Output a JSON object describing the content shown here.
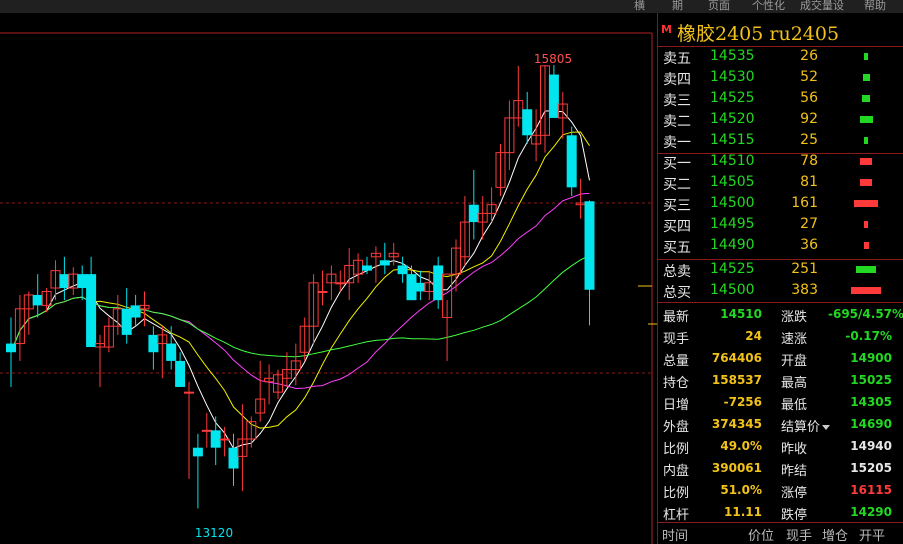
{
  "topbar": {
    "items": [
      "横",
      "期",
      "页面",
      "个性化",
      "成交量设",
      "帮助"
    ]
  },
  "chart": {
    "high_label": "15805",
    "low_label": "13120"
  },
  "chart_data": {
    "type": "candlestick",
    "ylim": [
      13000,
      16000
    ],
    "candles": [
      [
        14200,
        14350,
        13950,
        14150
      ],
      [
        14200,
        14480,
        14100,
        14400
      ],
      [
        14400,
        14500,
        14250,
        14480
      ],
      [
        14480,
        14600,
        14350,
        14420
      ],
      [
        14420,
        14520,
        14380,
        14500
      ],
      [
        14520,
        14680,
        14450,
        14620
      ],
      [
        14600,
        14700,
        14450,
        14520
      ],
      [
        14520,
        14640,
        14480,
        14600
      ],
      [
        14600,
        14650,
        14450,
        14520
      ],
      [
        14600,
        14700,
        14200,
        14180
      ],
      [
        14180,
        14250,
        13950,
        14200
      ],
      [
        14180,
        14350,
        14150,
        14300
      ],
      [
        14300,
        14480,
        14250,
        14400
      ],
      [
        14400,
        14520,
        14200,
        14250
      ],
      [
        14420,
        14480,
        14300,
        14350
      ],
      [
        14400,
        14500,
        14300,
        14420
      ],
      [
        14250,
        14300,
        14050,
        14150
      ],
      [
        14200,
        14300,
        14000,
        14250
      ],
      [
        14200,
        14300,
        14050,
        14100
      ],
      [
        14100,
        14150,
        13950,
        13950
      ],
      [
        13920,
        13980,
        13420,
        13920
      ],
      [
        13600,
        13680,
        13250,
        13550
      ],
      [
        13700,
        13800,
        13600,
        13700
      ],
      [
        13700,
        13780,
        13500,
        13600
      ],
      [
        13650,
        13720,
        13550,
        13650
      ],
      [
        13600,
        13680,
        13380,
        13480
      ],
      [
        13550,
        13850,
        13350,
        13650
      ],
      [
        13650,
        13780,
        13600,
        13750
      ],
      [
        13800,
        14100,
        13750,
        13880
      ],
      [
        13980,
        14080,
        13850,
        14000
      ],
      [
        13920,
        14050,
        13880,
        14020
      ],
      [
        14000,
        14150,
        13950,
        14050
      ],
      [
        14050,
        14200,
        13960,
        14100
      ],
      [
        14150,
        14350,
        14100,
        14300
      ],
      [
        14300,
        14600,
        14200,
        14550
      ],
      [
        14500,
        14620,
        14420,
        14500
      ],
      [
        14550,
        14650,
        14450,
        14600
      ],
      [
        14550,
        14620,
        14500,
        14550
      ],
      [
        14550,
        14750,
        14450,
        14650
      ],
      [
        14600,
        14720,
        14550,
        14680
      ],
      [
        14650,
        14700,
        14600,
        14620
      ],
      [
        14700,
        14760,
        14550,
        14720
      ],
      [
        14680,
        14780,
        14600,
        14650
      ],
      [
        14700,
        14780,
        14650,
        14720
      ],
      [
        14650,
        14700,
        14550,
        14600
      ],
      [
        14600,
        14650,
        14450,
        14450
      ],
      [
        14550,
        14620,
        14450,
        14500
      ],
      [
        14500,
        14620,
        14450,
        14550
      ],
      [
        14650,
        14700,
        14400,
        14450
      ],
      [
        14350,
        14450,
        14100,
        14600
      ],
      [
        14600,
        14800,
        14500,
        14750
      ],
      [
        14700,
        15050,
        14650,
        14900
      ],
      [
        15000,
        15200,
        14800,
        14900
      ],
      [
        14900,
        15050,
        14800,
        14950
      ],
      [
        14950,
        15100,
        14900,
        15000
      ],
      [
        15100,
        15350,
        15050,
        15300
      ],
      [
        15300,
        15600,
        15200,
        15500
      ],
      [
        15500,
        15800,
        15450,
        15600
      ],
      [
        15550,
        15650,
        15350,
        15400
      ],
      [
        15350,
        15550,
        15250,
        15400
      ],
      [
        15400,
        15805,
        15300,
        15800
      ],
      [
        15750,
        15805,
        15500,
        15500
      ],
      [
        15500,
        15650,
        15380,
        15580
      ],
      [
        15400,
        15450,
        15050,
        15100
      ],
      [
        15000,
        15150,
        14920,
        15010
      ],
      [
        15020,
        15025,
        14305,
        14510
      ]
    ],
    "ma_series": [
      {
        "color": "#ffffff"
      },
      {
        "color": "#f0f000"
      },
      {
        "color": "#ff40ff"
      },
      {
        "color": "#40ff40"
      }
    ]
  },
  "panel": {
    "title": "橡胶2405  ru2405",
    "mlogo": "M",
    "asks": [
      {
        "label": "卖五",
        "price": "14535",
        "vol": "26"
      },
      {
        "label": "卖四",
        "price": "14530",
        "vol": "52"
      },
      {
        "label": "卖三",
        "price": "14525",
        "vol": "56"
      },
      {
        "label": "卖二",
        "price": "14520",
        "vol": "92"
      },
      {
        "label": "卖一",
        "price": "14515",
        "vol": "25"
      }
    ],
    "bids": [
      {
        "label": "买一",
        "price": "14510",
        "vol": "78"
      },
      {
        "label": "买二",
        "price": "14505",
        "vol": "81"
      },
      {
        "label": "买三",
        "price": "14500",
        "vol": "161"
      },
      {
        "label": "买四",
        "price": "14495",
        "vol": "27"
      },
      {
        "label": "买五",
        "price": "14490",
        "vol": "36"
      }
    ],
    "totals": [
      {
        "label": "总卖",
        "price": "14525",
        "vol": "251"
      },
      {
        "label": "总买",
        "price": "14500",
        "vol": "383"
      }
    ],
    "stats": [
      {
        "l1": "最新",
        "v1": "14510",
        "c1": "green",
        "l2": "涨跌",
        "v2": "-695/4.57%",
        "c2": "green"
      },
      {
        "l1": "现手",
        "v1": "24",
        "c1": "yellow",
        "l2": "速涨",
        "v2": "-0.17%",
        "c2": "green"
      },
      {
        "l1": "总量",
        "v1": "764406",
        "c1": "yellow",
        "l2": "开盘",
        "v2": "14900",
        "c2": "green"
      },
      {
        "l1": "持仓",
        "v1": "158537",
        "c1": "yellow",
        "l2": "最高",
        "v2": "15025",
        "c2": "green"
      },
      {
        "l1": "日增",
        "v1": "-7256",
        "c1": "yellow",
        "l2": "最低",
        "v2": "14305",
        "c2": "green"
      },
      {
        "l1": "外盘",
        "v1": "374345",
        "c1": "yellow",
        "l2": "结算价",
        "v2": "14690",
        "c2": "green"
      },
      {
        "l1": "比例",
        "v1": "49.0%",
        "c1": "yellow",
        "l2": "昨收",
        "v2": "14940",
        "c2": "white"
      },
      {
        "l1": "内盘",
        "v1": "390061",
        "c1": "yellow",
        "l2": "昨结",
        "v2": "15205",
        "c2": "white"
      },
      {
        "l1": "比例",
        "v1": "51.0%",
        "c1": "yellow",
        "l2": "涨停",
        "v2": "16115",
        "c2": "red"
      },
      {
        "l1": "杠杆",
        "v1": "11.11",
        "c1": "yellow",
        "l2": "跌停",
        "v2": "14290",
        "c2": "green"
      }
    ],
    "tabs": [
      "时间",
      "价位",
      "现手",
      "增仓",
      "开平"
    ]
  }
}
